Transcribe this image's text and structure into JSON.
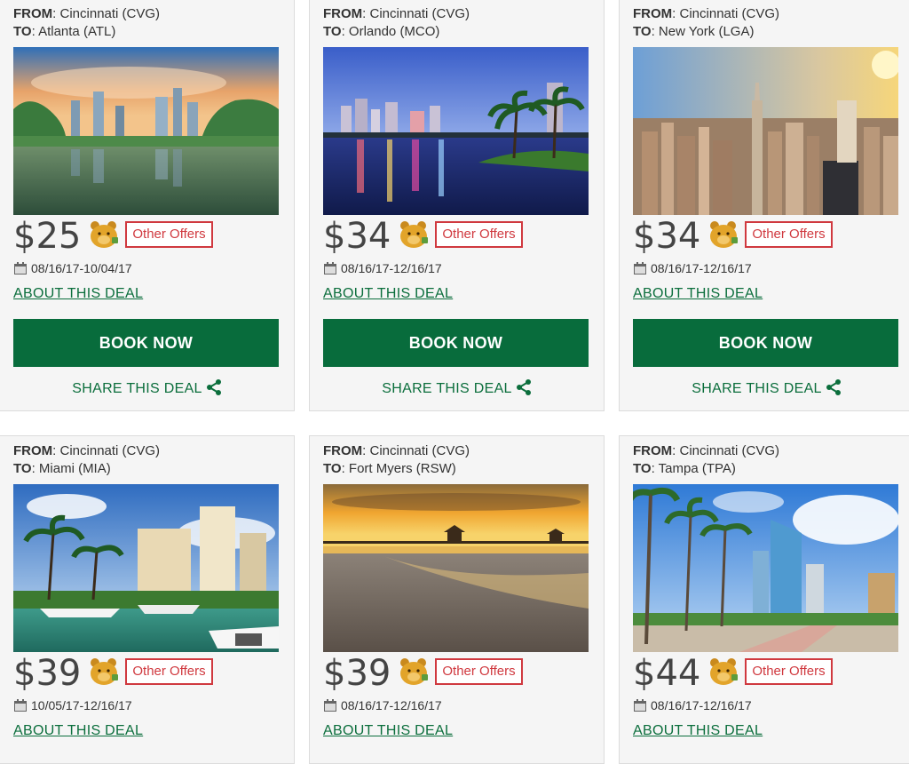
{
  "labels": {
    "from": "FROM",
    "to": "TO",
    "other_offers": "Other Offers",
    "about": "ABOUT THIS DEAL",
    "book": "BOOK NOW",
    "share": "SHARE THIS DEAL"
  },
  "colors": {
    "book_button": "#086c3c",
    "link_green": "#0b6e3c",
    "offers_red": "#d0393f",
    "card_bg": "#f5f5f5"
  },
  "deals": [
    {
      "from": "Cincinnati (CVG)",
      "to": "Atlanta (ATL)",
      "price": "$25",
      "dates": "08/16/17-10/04/17",
      "image": "atlanta-skyline-lake"
    },
    {
      "from": "Cincinnati (CVG)",
      "to": "Orlando (MCO)",
      "price": "$34",
      "dates": "08/16/17-12/16/17",
      "image": "orlando-lake-night"
    },
    {
      "from": "Cincinnati (CVG)",
      "to": "New York (LGA)",
      "price": "$34",
      "dates": "08/16/17-12/16/17",
      "image": "new-york-skyline"
    },
    {
      "from": "Cincinnati (CVG)",
      "to": "Miami (MIA)",
      "price": "$39",
      "dates": "10/05/17-12/16/17",
      "image": "miami-marina"
    },
    {
      "from": "Cincinnati (CVG)",
      "to": "Fort Myers (RSW)",
      "price": "$39",
      "dates": "08/16/17-12/16/17",
      "image": "fort-myers-pier-sunset"
    },
    {
      "from": "Cincinnati (CVG)",
      "to": "Tampa (TPA)",
      "price": "$44",
      "dates": "08/16/17-12/16/17",
      "image": "tampa-palms-tower"
    }
  ]
}
